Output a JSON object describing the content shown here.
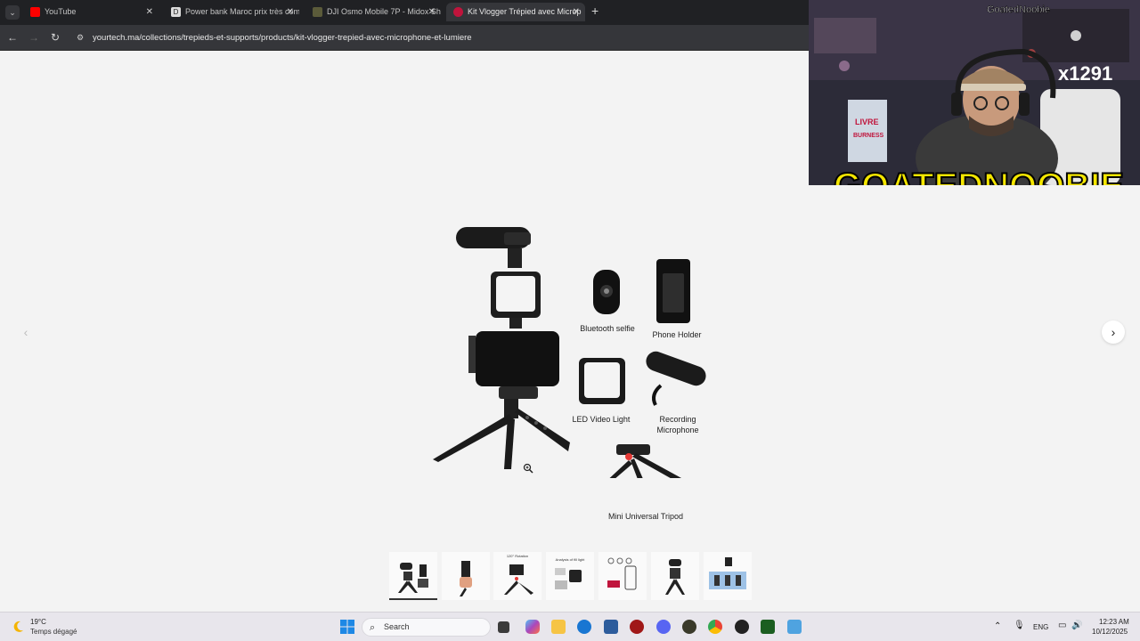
{
  "browser": {
    "tabs": [
      {
        "title": "YouTube",
        "favicon_color": "#ff0000",
        "active": false
      },
      {
        "title": "Power bank Maroc prix très com",
        "favicon_color": "#cfcfcf",
        "active": false
      },
      {
        "title": "DJI Osmo Mobile 7P - Midox Sh",
        "favicon_color": "#5b5b3a",
        "active": false
      },
      {
        "title": "Kit Vlogger Trépied avec Microp",
        "favicon_color": "#c0143c",
        "active": true
      }
    ],
    "new_tab": "+",
    "url": "yourtech.ma/collections/trepieds-et-supports/products/kit-vlogger-trepied-avec-microphone-et-lumiere"
  },
  "product_image": {
    "captions": {
      "bluetooth": "Bluetooth selfie",
      "holder": "Phone Holder",
      "light": "LED Video Light",
      "mic": "Recording\nMicrophone",
      "tripod": "Mini Universal Tripod"
    },
    "thumbnail_texts": {
      "t3": "120° Rotation",
      "t4": "Analysis of fill light"
    },
    "thumbnail_count": 7,
    "active_thumbnail": 1
  },
  "overlay": {
    "channel": "GoatedNoobie",
    "logo_text": "GOATEDNOOBIE",
    "counter": "x1291",
    "book_text": "LIVRE BURNESS"
  },
  "taskbar": {
    "temperature": "19°C",
    "condition": "Temps dégagé",
    "search_placeholder": "Search",
    "language": "ENG",
    "time": "12:23 AM",
    "date": "10/12/2025"
  },
  "colors": {
    "accent_red": "#e53935",
    "chrome_dark": "#202124"
  }
}
